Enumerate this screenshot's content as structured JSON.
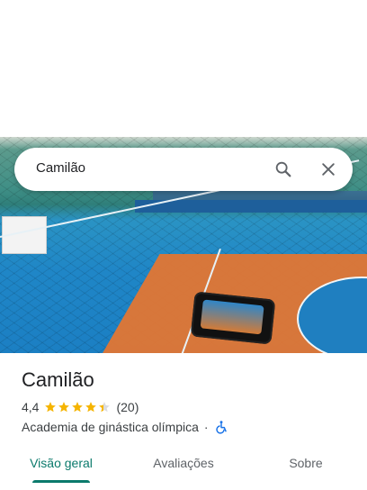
{
  "search": {
    "value": "Camilão",
    "search_icon": "search-icon",
    "close_icon": "close-icon"
  },
  "place": {
    "name": "Camilão",
    "rating": "4,4",
    "rating_value": 4.4,
    "reviews_count": "(20)",
    "category": "Academia de ginástica olímpica",
    "separator": "·",
    "accessibility_icon": "wheelchair-accessible-icon"
  },
  "tabs": [
    {
      "label": "Visão geral",
      "active": true
    },
    {
      "label": "Avaliações",
      "active": false
    },
    {
      "label": "Sobre",
      "active": false
    }
  ],
  "colors": {
    "accent": "#0b7a6c",
    "star": "#f5b400",
    "access_icon": "#1a73e8"
  }
}
